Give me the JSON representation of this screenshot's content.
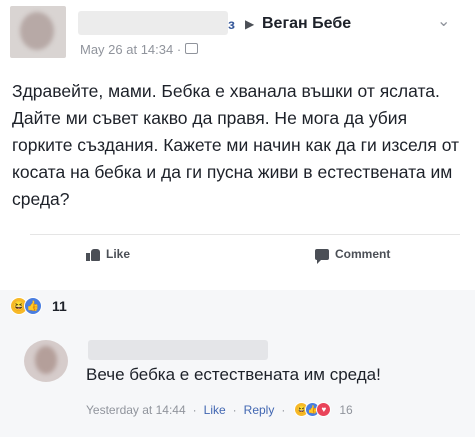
{
  "post": {
    "author_tail": "з",
    "group_name": "Веган Бебе",
    "timestamp": "May 26 at 14:34 · ",
    "body": "Здравейте, мами. Бебка е хванала въшки от яслата. Дайте ми съвет какво да правя. Не мога да убия горките създания. Кажете ми начин как да ги изселя от косата на бебка и да ги пусна живи в естествената им среда?",
    "like_label": "Like",
    "comment_label": "Comment"
  },
  "reactions": {
    "count": "11",
    "icons": [
      "haha-icon",
      "like-icon",
      "love-icon"
    ]
  },
  "comment": {
    "text": "Вече бебка е естествената им среда!",
    "time": "Yesterday at 14:44",
    "like_label": "Like",
    "reply_label": "Reply",
    "reaction_count": "16"
  },
  "colors": {
    "link": "#4267b2",
    "text": "#1d2129",
    "muted": "#90949c",
    "background_comment": "#f6f7f9"
  }
}
